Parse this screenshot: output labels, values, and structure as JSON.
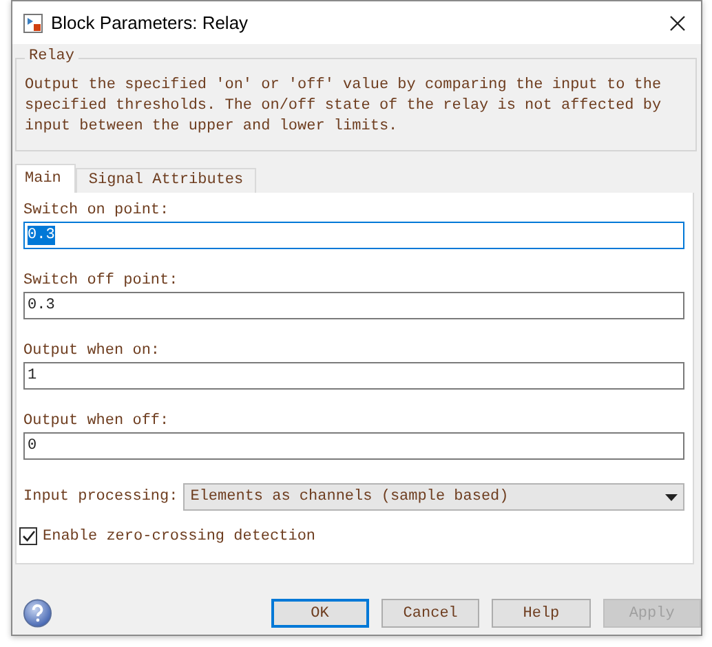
{
  "window": {
    "title": "Block Parameters: Relay"
  },
  "description": {
    "title": "Relay",
    "text": "Output the specified 'on' or 'off' value by comparing the input to the specified thresholds.  The on/off state of the relay is not affected by input between the upper and lower limits."
  },
  "tabs": [
    {
      "label": "Main",
      "selected": true
    },
    {
      "label": "Signal Attributes",
      "selected": false
    }
  ],
  "parameters": [
    {
      "kind": "text",
      "label": "Switch on point:",
      "value": "0.3",
      "focused": true
    },
    {
      "kind": "text",
      "label": "Switch off point:",
      "value": "0.3",
      "focused": false
    },
    {
      "kind": "text",
      "label": "Output when on:",
      "value": "1",
      "focused": false
    },
    {
      "kind": "text",
      "label": "Output when off:",
      "value": "0",
      "focused": false
    },
    {
      "kind": "dropdown",
      "label": "Input processing:",
      "value": "Elements as channels (sample based)"
    },
    {
      "kind": "checkbox",
      "label": "Enable zero-crossing detection",
      "checked": true
    }
  ],
  "buttons": [
    {
      "label": "OK",
      "default": true,
      "disabled": false
    },
    {
      "label": "Cancel",
      "default": false,
      "disabled": false
    },
    {
      "label": "Help",
      "default": false,
      "disabled": false
    },
    {
      "label": "Apply",
      "default": false,
      "disabled": true
    }
  ]
}
